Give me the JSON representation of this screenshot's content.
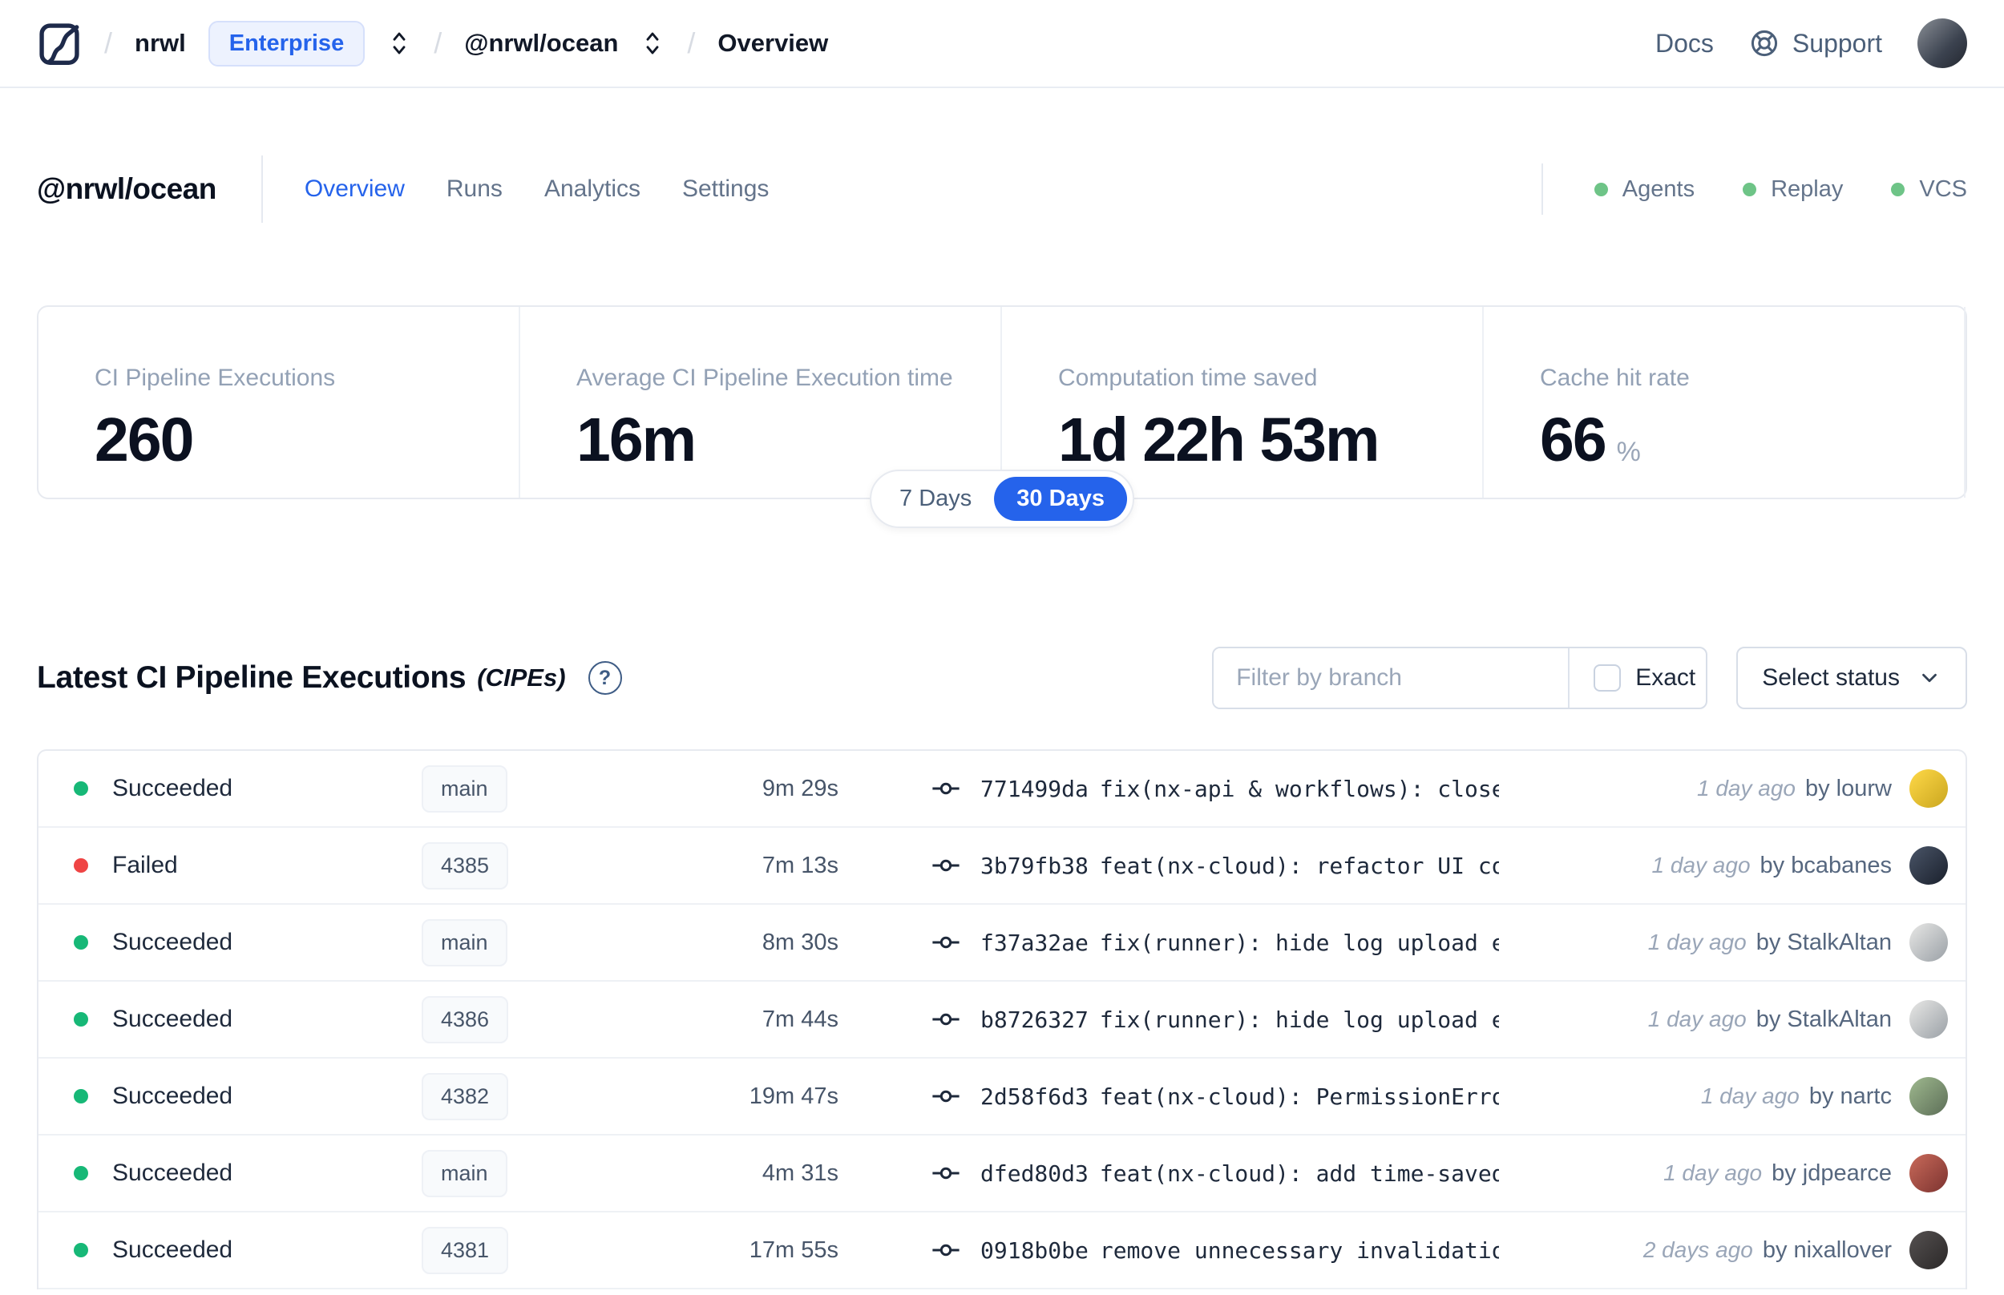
{
  "colors": {
    "accent_blue": "#2563eb",
    "succeeded": "#17b877",
    "failed": "#ef4444",
    "online_green": "#6ec487"
  },
  "navbar": {
    "breadcrumb": {
      "separator": "/",
      "org": "nrwl",
      "org_badge": "Enterprise",
      "workspace": "@nrwl/ocean",
      "page": "Overview"
    },
    "links": {
      "docs": "Docs",
      "support": "Support"
    }
  },
  "workspace_header": {
    "title": "@nrwl/ocean",
    "tabs": [
      {
        "label": "Overview",
        "active": true
      },
      {
        "label": "Runs",
        "active": false
      },
      {
        "label": "Analytics",
        "active": false
      },
      {
        "label": "Settings",
        "active": false
      }
    ],
    "statuses": [
      {
        "label": "Agents"
      },
      {
        "label": "Replay"
      },
      {
        "label": "VCS"
      }
    ]
  },
  "stats": {
    "cards": [
      {
        "label": "CI Pipeline Executions",
        "value": "260",
        "suffix": ""
      },
      {
        "label": "Average CI Pipeline Execution time",
        "value": "16m",
        "suffix": ""
      },
      {
        "label": "Computation time saved",
        "value": "1d 22h 53m",
        "suffix": ""
      },
      {
        "label": "Cache hit rate",
        "value": "66",
        "suffix": "%"
      }
    ],
    "range_toggle": {
      "options": [
        "7 Days",
        "30 Days"
      ],
      "selected": "30 Days"
    }
  },
  "cipe_section": {
    "title": "Latest CI Pipeline Executions",
    "title_suffix": "(CIPEs)",
    "help_glyph": "?",
    "filter_placeholder": "Filter by branch",
    "exact_label": "Exact",
    "status_dropdown": "Select status"
  },
  "table": {
    "rows": [
      {
        "status": "Succeeded",
        "status_type": "succeeded",
        "branch": "main",
        "duration": "9m 29s",
        "hash": "771499da",
        "message": "fix(nx-api & workflows): close workfl…",
        "time_ago": "1 day ago",
        "author": "by lourw",
        "avatar_colors": [
          "#ffd948",
          "#caa61f"
        ]
      },
      {
        "status": "Failed",
        "status_type": "failed",
        "branch": "4385",
        "duration": "7m 13s",
        "hash": "3b79fb38",
        "message": "feat(nx-cloud): refactor UI component…",
        "time_ago": "1 day ago",
        "author": "by bcabanes",
        "avatar_colors": [
          "#4a5568",
          "#1a202c"
        ]
      },
      {
        "status": "Succeeded",
        "status_type": "succeeded",
        "branch": "main",
        "duration": "8m 30s",
        "hash": "f37a32ae",
        "message": "fix(runner): hide log upload errors b…",
        "time_ago": "1 day ago",
        "author": "by StalkAltan",
        "avatar_colors": [
          "#e8e8e6",
          "#9aa0a6"
        ]
      },
      {
        "status": "Succeeded",
        "status_type": "succeeded",
        "branch": "4386",
        "duration": "7m 44s",
        "hash": "b8726327",
        "message": "fix(runner): hide log upload errors b…",
        "time_ago": "1 day ago",
        "author": "by StalkAltan",
        "avatar_colors": [
          "#e8e8e6",
          "#9aa0a6"
        ]
      },
      {
        "status": "Succeeded",
        "status_type": "succeeded",
        "branch": "4382",
        "duration": "19m 47s",
        "hash": "2d58f6d3",
        "message": "feat(nx-cloud): PermissionError and N…",
        "time_ago": "1 day ago",
        "author": "by nartc",
        "avatar_colors": [
          "#9fb98f",
          "#5c6e57"
        ]
      },
      {
        "status": "Succeeded",
        "status_type": "succeeded",
        "branch": "main",
        "duration": "4m 31s",
        "hash": "dfed80d3",
        "message": "feat(nx-cloud): add time-saved end po…",
        "time_ago": "1 day ago",
        "author": "by jdpearce",
        "avatar_colors": [
          "#c96a5a",
          "#7c3330"
        ]
      },
      {
        "status": "Succeeded",
        "status_type": "succeeded",
        "branch": "4381",
        "duration": "17m 55s",
        "hash": "0918b0be",
        "message": "remove unnecessary invalidation",
        "time_ago": "2 days ago",
        "author": "by nixallover",
        "avatar_colors": [
          "#555151",
          "#2b2828"
        ]
      }
    ]
  }
}
